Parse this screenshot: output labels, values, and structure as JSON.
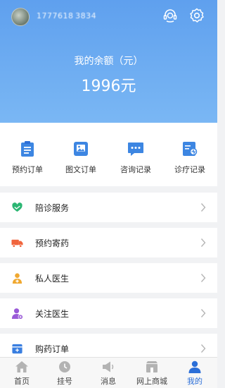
{
  "header": {
    "phone": "1777618 3834",
    "headset_icon": "customer-service-icon",
    "settings_icon": "gear-icon"
  },
  "balance": {
    "label": "我的余额（元）",
    "value": "1996元"
  },
  "quick_actions": [
    {
      "label": "预约订单",
      "icon": "clipboard-icon"
    },
    {
      "label": "图文订单",
      "icon": "image-icon"
    },
    {
      "label": "咨询记录",
      "icon": "chat-bubble-icon"
    },
    {
      "label": "诊疗记录",
      "icon": "medical-record-icon"
    }
  ],
  "menu": [
    {
      "label": "陪诊服务",
      "icon": "heart-hands-icon",
      "color": "#2bb673"
    },
    {
      "label": "预约寄药",
      "icon": "truck-icon",
      "color": "#f0643c"
    },
    {
      "label": "私人医生",
      "icon": "doctor-icon",
      "color": "#f0a830"
    },
    {
      "label": "关注医生",
      "icon": "follow-user-icon",
      "color": "#9a5ad8"
    },
    {
      "label": "购药订单",
      "icon": "order-box-icon",
      "color": "#3a7fe0"
    }
  ],
  "tabs": [
    {
      "label": "首页",
      "icon": "home-icon"
    },
    {
      "label": "挂号",
      "icon": "clock-icon"
    },
    {
      "label": "消息",
      "icon": "megaphone-icon"
    },
    {
      "label": "网上商城",
      "icon": "shop-icon"
    },
    {
      "label": "我的",
      "icon": "user-icon",
      "active": true
    }
  ],
  "colors": {
    "primary": "#2c6fd8",
    "hero_top": "#5fa0ee",
    "icon_blue": "#3d86e2"
  }
}
